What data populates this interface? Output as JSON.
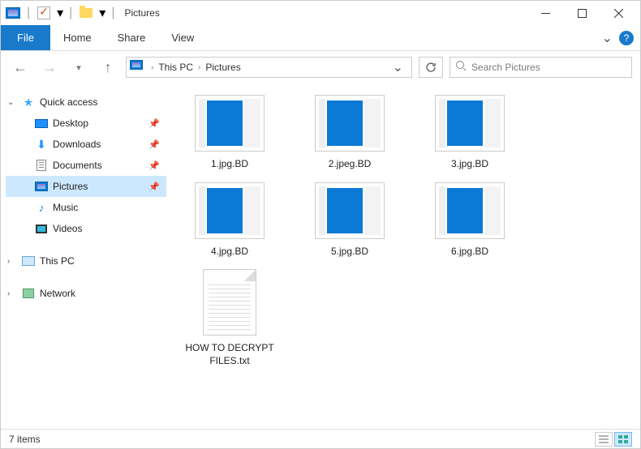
{
  "window": {
    "title": "Pictures"
  },
  "ribbon": {
    "file": "File",
    "tabs": [
      "Home",
      "Share",
      "View"
    ]
  },
  "breadcrumb": {
    "items": [
      "This PC",
      "Pictures"
    ]
  },
  "search": {
    "placeholder": "Search Pictures"
  },
  "sidebar": {
    "quick_access": {
      "label": "Quick access",
      "items": [
        {
          "label": "Desktop",
          "pinned": true,
          "icon": "desktop"
        },
        {
          "label": "Downloads",
          "pinned": true,
          "icon": "download"
        },
        {
          "label": "Documents",
          "pinned": true,
          "icon": "doc"
        },
        {
          "label": "Pictures",
          "pinned": true,
          "icon": "pic",
          "selected": true
        },
        {
          "label": "Music",
          "pinned": false,
          "icon": "music"
        },
        {
          "label": "Videos",
          "pinned": false,
          "icon": "video"
        }
      ]
    },
    "this_pc": {
      "label": "This PC"
    },
    "network": {
      "label": "Network"
    }
  },
  "files": [
    {
      "name": "1.jpg.BD",
      "type": "image"
    },
    {
      "name": "2.jpeg.BD",
      "type": "image"
    },
    {
      "name": "3.jpg.BD",
      "type": "image"
    },
    {
      "name": "4.jpg.BD",
      "type": "image"
    },
    {
      "name": "5.jpg.BD",
      "type": "image"
    },
    {
      "name": "6.jpg.BD",
      "type": "image"
    },
    {
      "name": "HOW TO DECRYPT FILES.txt",
      "type": "text"
    }
  ],
  "status": {
    "item_count": "7 items"
  }
}
